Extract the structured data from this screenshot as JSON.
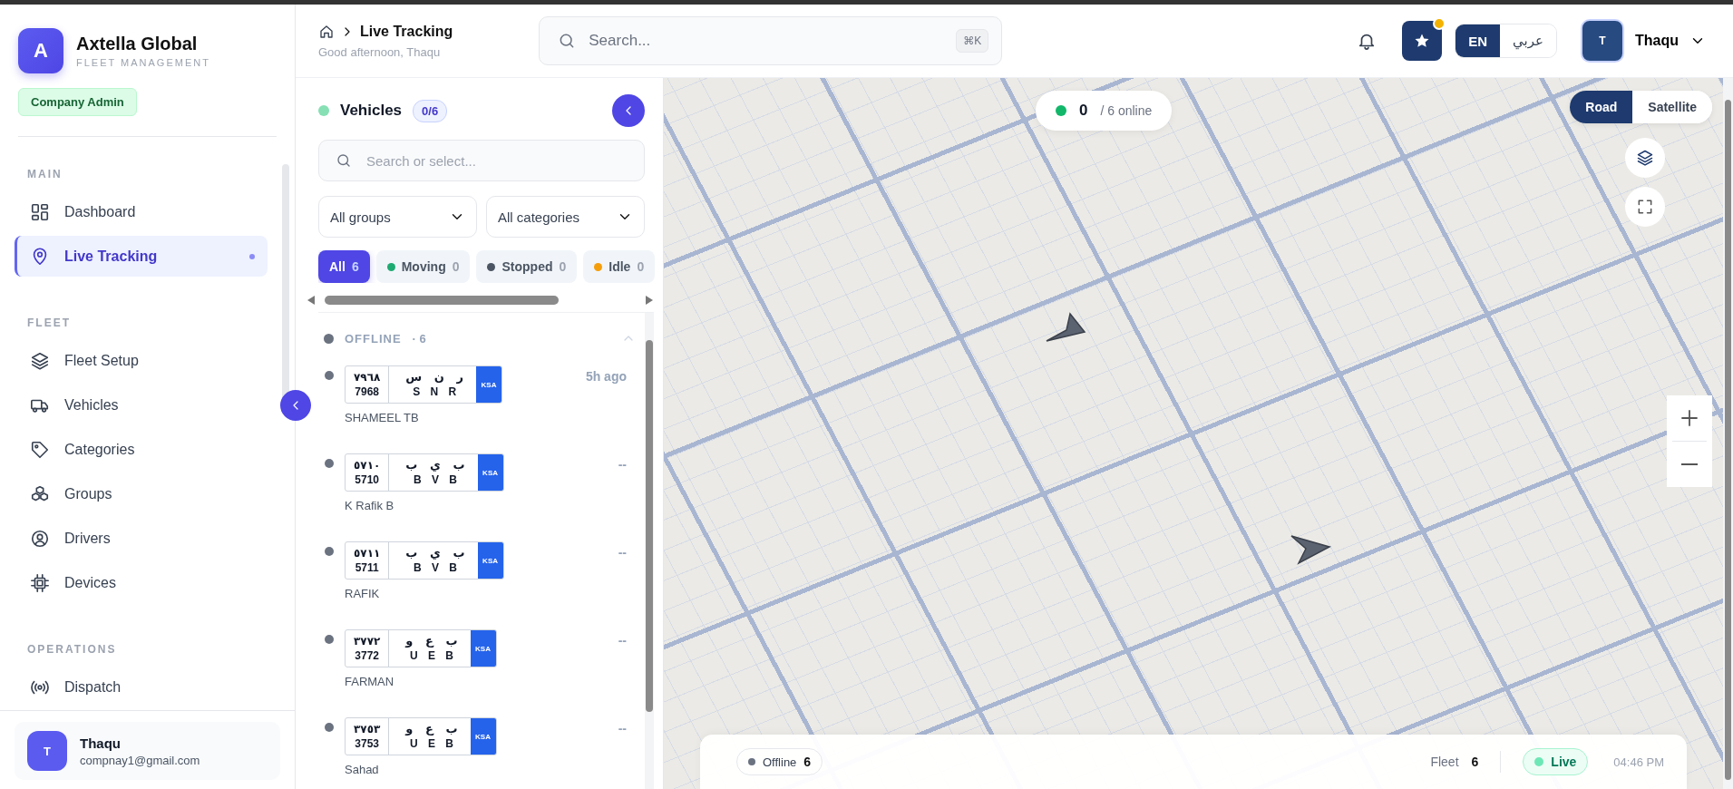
{
  "sidebar": {
    "brand": {
      "initial": "A",
      "name": "Axtella Global",
      "subtitle": "FLEET MANAGEMENT"
    },
    "role_badge": "Company Admin",
    "sections": [
      {
        "title": "MAIN",
        "items": [
          {
            "label": "Dashboard",
            "selected": false
          },
          {
            "label": "Live Tracking",
            "selected": true
          }
        ]
      },
      {
        "title": "FLEET",
        "items": [
          {
            "label": "Fleet Setup",
            "selected": false
          },
          {
            "label": "Vehicles",
            "selected": false
          },
          {
            "label": "Categories",
            "selected": false
          },
          {
            "label": "Groups",
            "selected": false
          },
          {
            "label": "Drivers",
            "selected": false
          },
          {
            "label": "Devices",
            "selected": false
          }
        ]
      },
      {
        "title": "OPERATIONS",
        "items": [
          {
            "label": "Dispatch",
            "selected": false
          }
        ]
      }
    ],
    "user": {
      "initial": "T",
      "name": "Thaqu",
      "email": "compnay1@gmail.com"
    }
  },
  "header": {
    "breadcrumb": "Live Tracking",
    "greeting": "Good afternoon, Thaqu",
    "search": {
      "placeholder": "Search...",
      "shortcut": "⌘K"
    },
    "favorites_badge": true,
    "languages": [
      {
        "label": "EN",
        "selected": true
      },
      {
        "label": "عربي",
        "selected": false
      }
    ],
    "user": {
      "initial": "T",
      "name": "Thaqu"
    }
  },
  "vehicles_panel": {
    "title": "Vehicles",
    "count": "0/6",
    "search": {
      "placeholder": "Search or select..."
    },
    "filters": [
      {
        "value": "All groups"
      },
      {
        "value": "All categories"
      }
    ],
    "status_tabs": [
      {
        "label": "All",
        "count": "6",
        "selected": true
      },
      {
        "label": "Moving",
        "count": "0",
        "color": "#1faa72",
        "selected": false
      },
      {
        "label": "Stopped",
        "count": "0",
        "color": "#4b5563",
        "selected": false
      },
      {
        "label": "Idle",
        "count": "0",
        "color": "#f59e0b",
        "selected": false
      }
    ],
    "groups": [
      {
        "label": "OFFLINE",
        "count": "· 6",
        "expanded": true,
        "vehicles": [
          {
            "plate": {
              "number_ar": "٧٩٦٨",
              "number": "7968",
              "letters_ar": "ر ن س",
              "letters": "S N R",
              "country": "KSA"
            },
            "name": "SHAMEEL TB",
            "last_seen": "5h ago"
          },
          {
            "plate": {
              "number_ar": "٥٧١٠",
              "number": "5710",
              "letters_ar": "ب ي ب",
              "letters": "B V B",
              "country": "KSA"
            },
            "name": "K Rafik B",
            "last_seen": "--"
          },
          {
            "plate": {
              "number_ar": "٥٧١١",
              "number": "5711",
              "letters_ar": "ب ي ب",
              "letters": "B V B",
              "country": "KSA"
            },
            "name": "RAFIK",
            "last_seen": "--"
          },
          {
            "plate": {
              "number_ar": "٣٧٧٢",
              "number": "3772",
              "letters_ar": "ب ع و",
              "letters": "U E B",
              "country": "KSA"
            },
            "name": "FARMAN",
            "last_seen": "--"
          },
          {
            "plate": {
              "number_ar": "٣٧٥٣",
              "number": "3753",
              "letters_ar": "ب ع و",
              "letters": "U E B",
              "country": "KSA"
            },
            "name": "Sahad",
            "last_seen": "--"
          }
        ]
      }
    ]
  },
  "map": {
    "online": {
      "count": "0",
      "label": "/ 6 online"
    },
    "map_types": [
      {
        "label": "Road",
        "selected": true
      },
      {
        "label": "Satellite",
        "selected": false
      }
    ],
    "status_bar": {
      "offline": {
        "label": "Offline",
        "count": "6"
      },
      "fleet": {
        "label": "Fleet",
        "count": "6"
      },
      "live": "Live",
      "time": "04:46 PM"
    }
  }
}
